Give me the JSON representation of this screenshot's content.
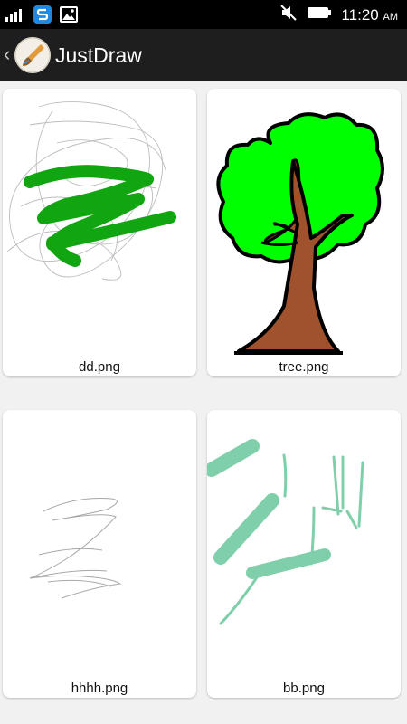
{
  "status_bar": {
    "time": "11:20",
    "ampm": "AM",
    "icons": [
      "signal-icon",
      "app-s-icon",
      "gallery-icon",
      "mute-icon",
      "battery-icon"
    ]
  },
  "action_bar": {
    "title": "JustDraw",
    "icons": [
      "back-chevron-icon",
      "paintbrush-logo-icon"
    ]
  },
  "drawings": [
    {
      "file": "dd.png"
    },
    {
      "file": "tree.png"
    },
    {
      "file": "hhhh.png"
    },
    {
      "file": "bb.png"
    }
  ],
  "colors": {
    "status_bar": "#000000",
    "action_bar": "#1e1e1e",
    "background": "#f1f1f1",
    "card": "#ffffff",
    "green_scribble": "#11a511",
    "tree_leaves": "#00ff00",
    "tree_trunk": "#a0522d",
    "teal_strokes": "#7fcfaa"
  }
}
